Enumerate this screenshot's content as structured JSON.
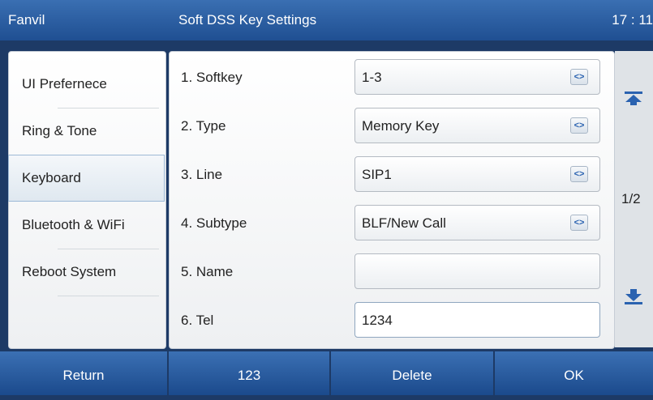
{
  "header": {
    "brand": "Fanvil",
    "title": "Soft DSS Key Settings",
    "time": "17 : 11"
  },
  "sidebar": {
    "items": [
      {
        "label": "UI Prefernece"
      },
      {
        "label": "Ring & Tone"
      },
      {
        "label": "Keyboard",
        "active": true
      },
      {
        "label": "Bluetooth & WiFi"
      },
      {
        "label": "Reboot System"
      }
    ]
  },
  "form": {
    "rows": [
      {
        "label": "1. Softkey",
        "value": "1-3"
      },
      {
        "label": "2. Type",
        "value": "Memory Key"
      },
      {
        "label": "3. Line",
        "value": "SIP1"
      },
      {
        "label": "4. Subtype",
        "value": "BLF/New Call"
      },
      {
        "label": "5. Name",
        "value": ""
      },
      {
        "label": "6. Tel",
        "value": "1234"
      }
    ]
  },
  "scroll": {
    "page": "1/2"
  },
  "footer": {
    "return": "Return",
    "mode": "123",
    "delete": "Delete",
    "ok": "OK"
  },
  "colors": {
    "header": "#2a5ca0",
    "background": "#1d3a66",
    "accent": "#2a62b0"
  },
  "icons": {
    "scroll_up": "scroll-top-icon",
    "scroll_down": "scroll-bottom-icon",
    "select": "left-right-arrows-icon"
  }
}
